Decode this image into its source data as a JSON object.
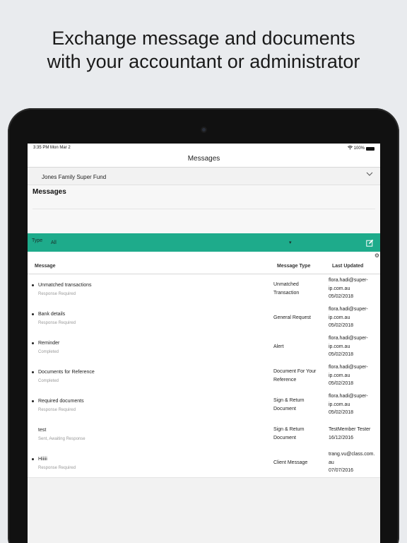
{
  "headline": {
    "line1": "Exchange message and documents",
    "line2": "with your accountant or administrator"
  },
  "statusbar": {
    "time": "3:35 PM  Mon Mar 2",
    "battery": "100%"
  },
  "nav": {
    "title": "Messages"
  },
  "fund": {
    "name": "Jones Family Super Fund"
  },
  "section": {
    "title": "Messages"
  },
  "filter": {
    "type_label": "Type",
    "type_value": "All"
  },
  "table": {
    "headers": {
      "message": "Message",
      "message_type": "Message Type",
      "last_updated": "Last Updated"
    },
    "rows": [
      {
        "title": "Unmatched transactions",
        "status": "Response Required",
        "type_l1": "Unmatched",
        "type_l2": "Transaction",
        "upd_l1": "flora.hadi@super-",
        "upd_l2": "ip.com.au",
        "upd_l3": "05/02/2018",
        "bullet": true
      },
      {
        "title": "Bank details",
        "status": "Response Required",
        "type_l1": "General Request",
        "type_l2": "",
        "upd_l1": "flora.hadi@super-",
        "upd_l2": "ip.com.au",
        "upd_l3": "05/02/2018",
        "bullet": true
      },
      {
        "title": "Reminder",
        "status": "Completed",
        "type_l1": "Alert",
        "type_l2": "",
        "upd_l1": "flora.hadi@super-",
        "upd_l2": "ip.com.au",
        "upd_l3": "05/02/2018",
        "bullet": true
      },
      {
        "title": "Documents for Reference",
        "status": "Completed",
        "type_l1": "Document For Your",
        "type_l2": "Reference",
        "upd_l1": "flora.hadi@super-",
        "upd_l2": "ip.com.au",
        "upd_l3": "05/02/2018",
        "bullet": true
      },
      {
        "title": "Required documents",
        "status": "Response Required",
        "type_l1": "Sign & Return",
        "type_l2": "Document",
        "upd_l1": "flora.hadi@super-",
        "upd_l2": "ip.com.au",
        "upd_l3": "05/02/2018",
        "bullet": true
      },
      {
        "title": "test",
        "status": "Sent, Awaiting Response",
        "type_l1": "Sign & Return",
        "type_l2": "Document",
        "upd_l1": "TestMember Tester",
        "upd_l2": "16/12/2016",
        "upd_l3": "",
        "bullet": false
      },
      {
        "title": "Hiiiii",
        "status": "Response Required",
        "type_l1": "Client Message",
        "type_l2": "",
        "upd_l1": "trang.vu@class.com.",
        "upd_l2": "au",
        "upd_l3": "07/07/2016",
        "bullet": true
      }
    ]
  },
  "colors": {
    "accent": "#1eab8b",
    "background": "#e9ebee"
  },
  "icons": {
    "dropdown": "chevron-down-icon",
    "compose": "compose-icon",
    "settings": "gear-icon",
    "wifi": "wifi-icon"
  }
}
